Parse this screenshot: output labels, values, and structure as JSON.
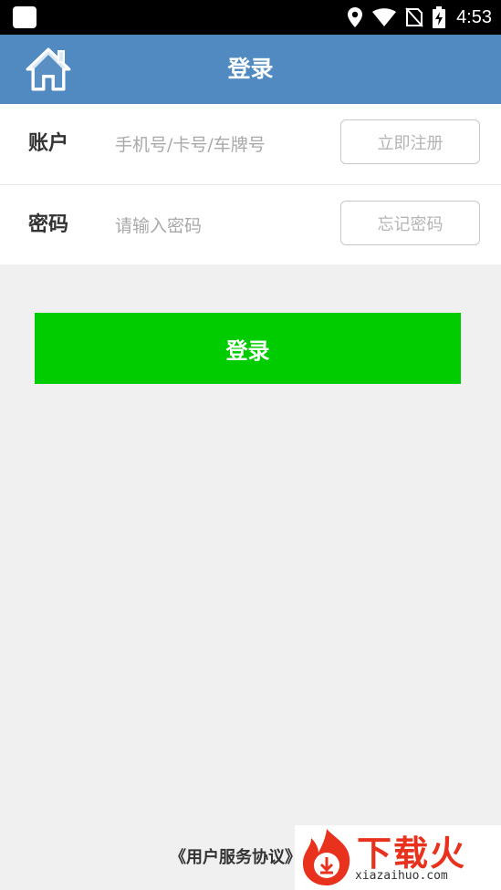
{
  "status_bar": {
    "time": "4:53",
    "icons": [
      "app-icon",
      "location-icon",
      "wifi-icon",
      "no-sim-icon",
      "battery-charging-icon"
    ]
  },
  "header": {
    "title": "登录",
    "home_icon": "home-icon"
  },
  "form": {
    "account": {
      "label": "账户",
      "placeholder": "手机号/卡号/车牌号",
      "value": "",
      "action_label": "立即注册"
    },
    "password": {
      "label": "密码",
      "placeholder": "请输入密码",
      "value": "",
      "action_label": "忘记密码"
    }
  },
  "login_button": {
    "label": "登录"
  },
  "footer": {
    "agreement_label": "《用户服务协议》"
  },
  "watermark": {
    "text": "下载火",
    "subtext": "xiazaihuo.com"
  },
  "colors": {
    "header_bg": "#508ac0",
    "login_button_bg": "#00cc00",
    "page_bg": "#f0f0f0",
    "watermark_red": "#e8321e"
  }
}
